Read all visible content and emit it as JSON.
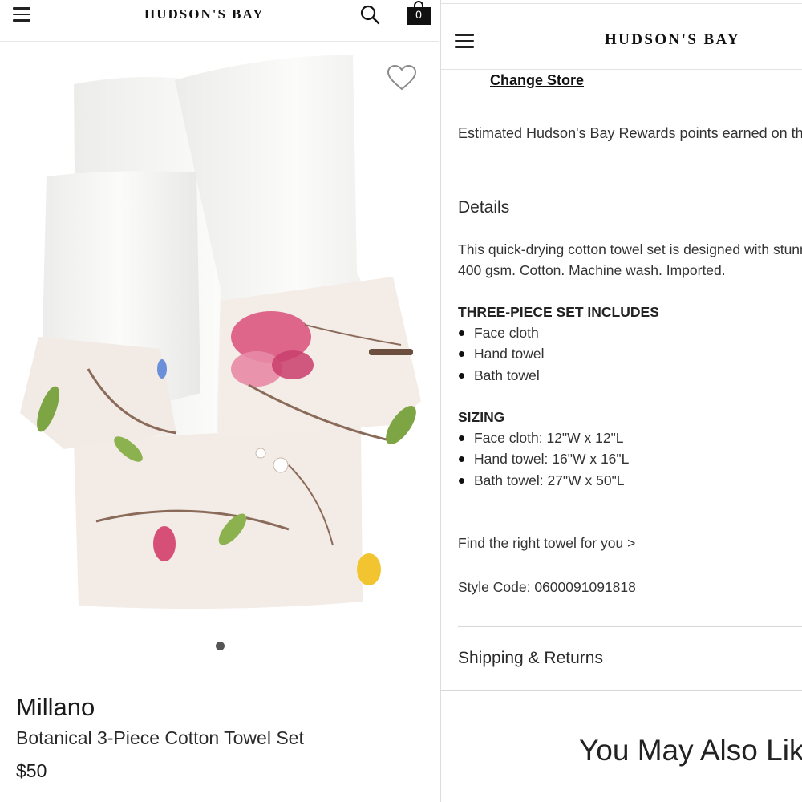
{
  "left_panel": {
    "header": {
      "menu_icon": "hamburger-menu-icon",
      "logo_text": "HUDSON'S BAY",
      "search_icon": "search-icon",
      "bag_icon": "shopping-bag-icon",
      "bag_count": "0"
    },
    "product": {
      "favorite_icon": "heart-outline-icon",
      "image_alt": "Botanical towel set image",
      "brand": "Millano",
      "name": "Botanical 3-Piece Cotton Towel Set",
      "price": "$50",
      "carousel_dots": 1
    }
  },
  "right_panel": {
    "header": {
      "menu_icon": "hamburger-menu-icon",
      "logo_text": "HUDSON'S BAY"
    },
    "change_store_label": "Change Store",
    "rewards_text": "Estimated Hudson's Bay Rewards points earned on this i",
    "details": {
      "title": "Details",
      "description_line1": "This quick-drying cotton towel set is designed with stunn",
      "description_line2": "400 gsm. Cotton. Machine wash. Imported.",
      "set_heading": "THREE-PIECE SET INCLUDES",
      "set_items": [
        "Face cloth",
        "Hand towel",
        "Bath towel"
      ],
      "sizing_heading": "SIZING",
      "sizing_items": [
        "Face cloth: 12\"W x 12\"L",
        "Hand towel: 16\"W x 16\"L",
        "Bath towel: 27\"W x 50\"L"
      ],
      "find_towel_link": "Find the right towel for you >",
      "style_code": "Style Code: 0600091091818"
    },
    "shipping_title": "Shipping & Returns",
    "also_like_title": "You May Also Like"
  },
  "colors": {
    "text_primary": "#222222",
    "divider": "#d8d8d8",
    "towel_white": "#f7f7f5",
    "floral_pink": "#d94f7a",
    "border_bg": "#f1e8e3"
  }
}
